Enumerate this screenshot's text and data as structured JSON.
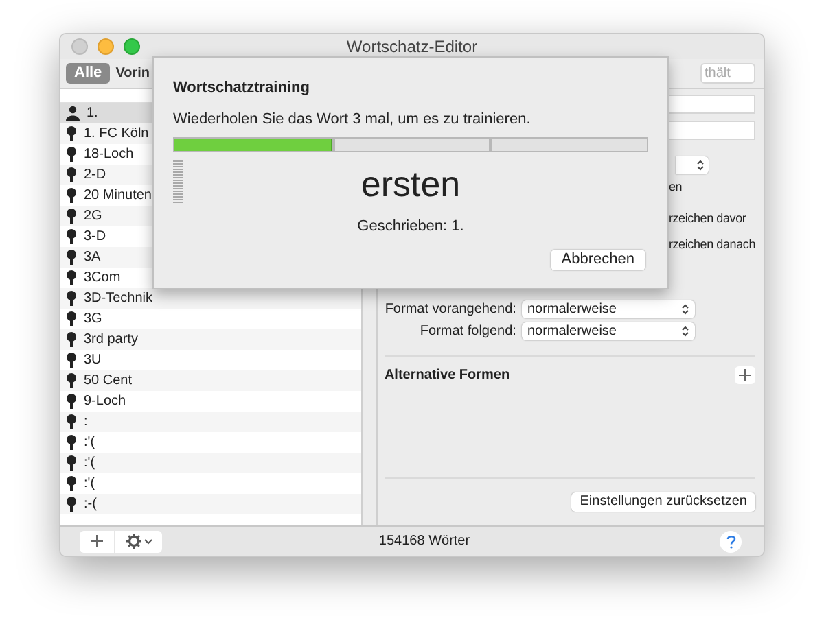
{
  "window": {
    "title": "Wortschatz-Editor"
  },
  "toolbar": {
    "filters": [
      {
        "label": "Alle",
        "selected": true
      },
      {
        "label": "Vorin",
        "selected": false
      }
    ],
    "search": {
      "placeholder": "thält"
    }
  },
  "words": [
    {
      "text": "1.",
      "kind": "person"
    },
    {
      "text": "1. FC Köln",
      "kind": "speech"
    },
    {
      "text": "18-Loch",
      "kind": "speech"
    },
    {
      "text": "2-D",
      "kind": "speech"
    },
    {
      "text": "20 Minuten",
      "kind": "speech"
    },
    {
      "text": "2G",
      "kind": "speech"
    },
    {
      "text": "3-D",
      "kind": "speech"
    },
    {
      "text": "3A",
      "kind": "speech"
    },
    {
      "text": "3Com",
      "kind": "speech"
    },
    {
      "text": "3D-Technik",
      "kind": "speech"
    },
    {
      "text": "3G",
      "kind": "speech"
    },
    {
      "text": "3rd party",
      "kind": "speech"
    },
    {
      "text": "3U",
      "kind": "speech"
    },
    {
      "text": "50 Cent",
      "kind": "speech"
    },
    {
      "text": "9-Loch",
      "kind": "speech"
    },
    {
      "text": ":",
      "kind": "speech"
    },
    {
      "text": ":'(",
      "kind": "speech"
    },
    {
      "text": ":'(",
      "kind": "speech"
    },
    {
      "text": ":'(",
      "kind": "speech"
    },
    {
      "text": ":-(",
      "kind": "speech"
    }
  ],
  "details": {
    "options": [
      "en",
      "rzeichen davor",
      "rzeichen danach"
    ],
    "formats": [
      {
        "label": "Format vorangehend:",
        "value": "normalerweise"
      },
      {
        "label": "Format folgend:",
        "value": "normalerweise"
      }
    ],
    "alternatives_title": "Alternative Formen",
    "reset_button": "Einstellungen zurücksetzen"
  },
  "status_bar": {
    "count": "154168 Wörter"
  },
  "sheet": {
    "title": "Wortschatztraining",
    "instruction": "Wiederholen Sie das Wort 3 mal, um es zu trainieren.",
    "level": 0.333,
    "word": "ersten",
    "written": "Geschrieben: 1.",
    "cancel_button": "Abbrechen"
  }
}
